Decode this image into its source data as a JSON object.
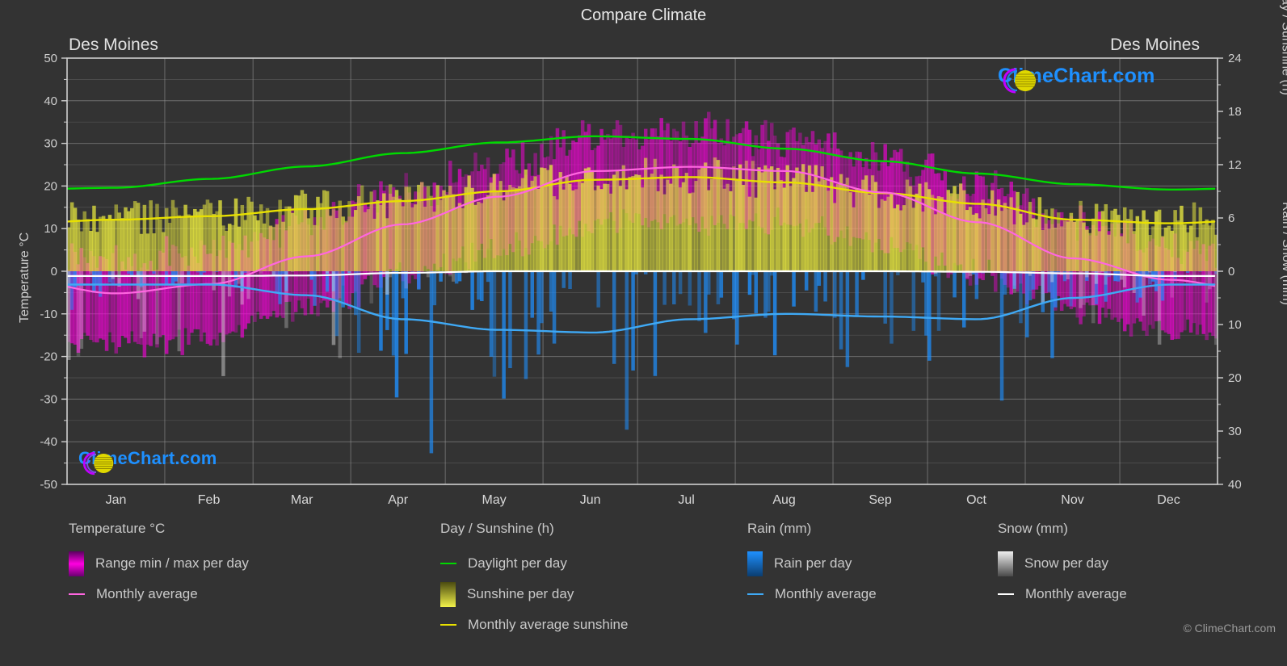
{
  "header": {
    "title": "Compare Climate",
    "location_left": "Des Moines",
    "location_right": "Des Moines"
  },
  "axes": {
    "y_left_label": "Temperature °C",
    "y_right_top_label": "Day / Sunshine (h)",
    "y_right_bottom_label": "Rain / Snow (mm)"
  },
  "watermark": {
    "text": "ClimeChart.com",
    "logo_arc_color": "#c000ff",
    "logo_sphere_color": "#e8e000",
    "text_color": "#1e90ff"
  },
  "copyright": "© ClimeChart.com",
  "legend": {
    "temperature": {
      "title": "Temperature °C",
      "items": [
        {
          "label": "Range min / max per day",
          "marker": "gradient",
          "color": "#ff00e0"
        },
        {
          "label": "Monthly average",
          "marker": "line",
          "color": "#ff66e0"
        }
      ]
    },
    "daysun": {
      "title": "Day / Sunshine (h)",
      "items": [
        {
          "label": "Daylight per day",
          "marker": "line",
          "color": "#00d900"
        },
        {
          "label": "Sunshine per day",
          "marker": "gradient",
          "color": "#e8e840"
        },
        {
          "label": "Monthly average sunshine",
          "marker": "line",
          "color": "#e8e000"
        }
      ]
    },
    "rain": {
      "title": "Rain (mm)",
      "items": [
        {
          "label": "Rain per day",
          "marker": "gradient",
          "color": "#1e90ff"
        },
        {
          "label": "Monthly average",
          "marker": "line",
          "color": "#3fa9f5"
        }
      ]
    },
    "snow": {
      "title": "Snow (mm)",
      "items": [
        {
          "label": "Snow per day",
          "marker": "gradient",
          "color": "#e6e6e6"
        },
        {
          "label": "Monthly average",
          "marker": "line",
          "color": "#ffffff"
        }
      ]
    }
  },
  "chart_data": {
    "type": "line",
    "title": "Compare Climate",
    "subtitle": "Des Moines",
    "xlabel": "",
    "ylabel": "Temperature °C",
    "grid": true,
    "legend_position": "bottom",
    "months": [
      "Jan",
      "Feb",
      "Mar",
      "Apr",
      "May",
      "Jun",
      "Jul",
      "Aug",
      "Sep",
      "Oct",
      "Nov",
      "Dec"
    ],
    "axis_left": {
      "label": "Temperature °C",
      "ticks": [
        50,
        40,
        30,
        20,
        10,
        0,
        -10,
        -20,
        -30,
        -40,
        -50
      ],
      "ylim": [
        -50,
        50
      ],
      "unit": "°C"
    },
    "axis_right_top": {
      "label": "Day / Sunshine (h)",
      "ticks": [
        24,
        18,
        12,
        6,
        0
      ],
      "ylim": [
        0,
        24
      ],
      "unit": "h"
    },
    "axis_right_bottom": {
      "label": "Rain / Snow (mm)",
      "ticks": [
        0,
        10,
        20,
        30,
        40
      ],
      "ylim": [
        0,
        40
      ],
      "unit": "mm"
    },
    "series": [
      {
        "name": "Monthly average temperature",
        "color": "#ff66e0",
        "axis": "left",
        "unit": "°C",
        "values": [
          -5.2,
          -4.9,
          -4.5,
          -4.2,
          -1.5,
          3.0,
          7.5,
          11.5,
          12.0,
          13.0,
          18.0,
          22.5,
          24.0,
          24.5,
          24.0,
          21.0,
          15.5,
          11.5,
          10.0,
          4.0,
          -0.5,
          -1.5
        ]
      },
      {
        "name": "Monthly average temperature (monthly points)",
        "color": "#ff66e0",
        "axis": "left",
        "unit": "°C",
        "monthly": [
          -5.2,
          -3.0,
          3.5,
          11.0,
          17.5,
          23.5,
          24.5,
          23.5,
          18.5,
          11.5,
          3.0,
          -2.0
        ]
      },
      {
        "name": "Daylight per day",
        "color": "#00d900",
        "axis": "right_top",
        "unit": "h",
        "monthly": [
          9.4,
          10.4,
          11.8,
          13.3,
          14.5,
          15.2,
          14.9,
          13.8,
          12.4,
          11.0,
          9.8,
          9.2
        ]
      },
      {
        "name": "Monthly average sunshine",
        "color": "#e8e000",
        "axis": "right_top",
        "unit": "h",
        "monthly": [
          5.8,
          6.2,
          7.0,
          7.9,
          9.0,
          10.3,
          10.6,
          10.0,
          8.8,
          7.6,
          5.8,
          5.4
        ]
      },
      {
        "name": "Rain monthly average",
        "color": "#3fa9f5",
        "axis": "right_bottom",
        "unit": "mm",
        "monthly": [
          2.5,
          2.5,
          4.5,
          9.0,
          11.0,
          11.5,
          9.0,
          8.0,
          8.5,
          9.0,
          5.0,
          2.5
        ]
      },
      {
        "name": "Snow monthly average",
        "color": "#ffffff",
        "axis": "right_bottom",
        "unit": "mm",
        "monthly": [
          0.9,
          0.9,
          0.8,
          0.3,
          0.0,
          0.0,
          0.0,
          0.0,
          0.0,
          0.1,
          0.4,
          0.9
        ]
      }
    ],
    "bands": [
      {
        "name": "Temperature range min / max per day",
        "color": "#ff00e0",
        "axis": "left",
        "description": "Daily vertical magenta bars spanning min to max temperature"
      },
      {
        "name": "Sunshine per day",
        "color": "#e8e840",
        "axis": "right_top",
        "description": "Daily vertical yellow bars from 0 to sunshine hours"
      },
      {
        "name": "Rain per day",
        "color": "#1e90ff",
        "axis": "right_bottom",
        "description": "Daily vertical blue bars downward from 0"
      },
      {
        "name": "Snow per day",
        "color": "#e6e6e6",
        "axis": "right_bottom",
        "description": "Daily vertical grey bars downward from 0"
      }
    ]
  }
}
